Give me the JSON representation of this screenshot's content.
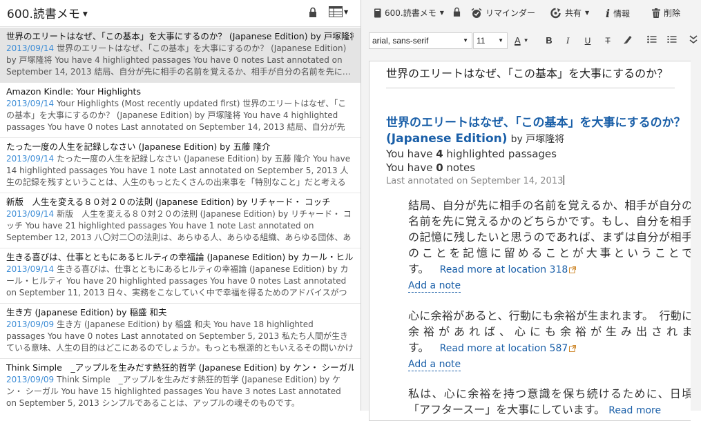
{
  "left": {
    "notebook": "600.読書メモ",
    "notes": [
      {
        "title": "世界のエリートはなぜ、「この基本」を大事にするのか？ (Japanese Edition) by 戸塚隆将",
        "date": "2013/09/14",
        "snippet": "世界のエリートはなぜ、「この基本」を大事にするのか？ (Japanese Edition) by 戸塚隆将 You have 4 highlighted passages You have 0 notes Last annotated on September 14, 2013 結局、自分が先に相手の名前を覚えるか、相手が自分の名前を先に…"
      },
      {
        "title": "Amazon Kindle: Your Highlights",
        "date": "2013/09/14",
        "snippet": "Your Highlights (Most recently updated first) 世界のエリートはなぜ、「この基本」を大事にするのか？ (Japanese Edition) by 戸塚隆将 You have 4 highlighted passages You have 0 notes Last annotated on September 14, 2013 結局、自分が先に…"
      },
      {
        "title": "たった一度の人生を記録しなさい (Japanese Edition) by 五藤 隆介",
        "date": "2013/09/14",
        "snippet": "たった一度の人生を記録しなさい (Japanese Edition) by 五藤 隆介 You have 14 highlighted passages You have 1 note Last annotated on September 5, 2013 人生の記録を残すということは、人生のもっとたくさんの出来事を「特別なこと」だと考えること…"
      },
      {
        "title": "新版　人生を変える８０対２０の法則 (Japanese Edition) by リチャード・ コッチ",
        "date": "2013/09/14",
        "snippet": "新版　人生を変える８０対２０の法則 (Japanese Edition) by リチャード・ コッチ You have 21 highlighted passages You have 1 note Last annotated on September 12, 2013 八〇対二〇の法則は、あらゆる人、あらゆる組織、あらゆる団体、あらゆる形態…"
      },
      {
        "title": "生きる喜びは、仕事とともにあるヒルティの幸福論 (Japanese Edition) by カール・ヒルティ",
        "date": "2013/09/14",
        "snippet": "生きる喜びは、仕事とともにあるヒルティの幸福論 (Japanese Edition) by カール・ヒルティ You have 20 highlighted passages You have 0 notes Last annotated on September 11, 2013 日々、実務をこなしていく中で幸福を得るためのアドバイスがつま…"
      },
      {
        "title": "生き方 (Japanese Edition) by 稲盛 和夫",
        "date": "2013/09/09",
        "snippet": "生き方 (Japanese Edition) by 稲盛 和夫 You have 18 highlighted passages You have 0 notes Last annotated on September 5, 2013 私たち人間が生きている意味、人生の目的はどこにあるのでしょうか。もっとも根源的ともいえるその問いかけに、私はや…"
      },
      {
        "title": "Think Simple　_アップルを生みだす熱狂的哲学 (Japanese Edition) by ケン・ シーガル",
        "date": "2013/09/09",
        "snippet": "Think Simple　_アップルを生みだす熱狂的哲学 (Japanese Edition) by ケン・ シーガル You have 15 highlighted passages You have 3 notes Last annotated on September 5, 2013 シンプルであることは、アップルの魂そのものです。"
      }
    ]
  },
  "toolbar": {
    "notebook": "600.読書メモ",
    "reminder": "リマインダー",
    "share": "共有",
    "info": "情報",
    "delete": "削除"
  },
  "format": {
    "font": "arial, sans-serif",
    "size": "11"
  },
  "editor": {
    "title": "世界のエリートはなぜ、「この基本」を大事にするのか？",
    "book_title": "世界のエリートはなぜ、「この基本」を大事にするのか？ (Japanese Edition)",
    "author": "by 戸塚隆将",
    "stat1_pre": "You have ",
    "stat1_num": "4",
    "stat1_post": " highlighted passages",
    "stat2_pre": "You have ",
    "stat2_num": "0",
    "stat2_post": " notes",
    "last_annotated": "Last annotated on September 14, 2013",
    "highlights": [
      {
        "text": "結局、自分が先に相手の名前を覚えるか、相手が自分の名前を先に覚えるかのどちらかです。もし、自分を相手の記憶に残したいと思うのであれば、まずは自分が相手のことを記憶に留めることが大事ということです。",
        "link": "Read more at location 318",
        "add_note": "Add a note"
      },
      {
        "text": "心に余裕があると、行動にも余裕が生まれます。　行動に余裕があれば、心にも余裕が生み出されます。",
        "link": "Read more at location 587",
        "add_note": "Add a note"
      },
      {
        "text": "私は、心に余裕を持つ意識を保ち続けるために、日頃「アフタースー」を大事にしています。",
        "link": "Read more",
        "add_note": ""
      }
    ]
  }
}
